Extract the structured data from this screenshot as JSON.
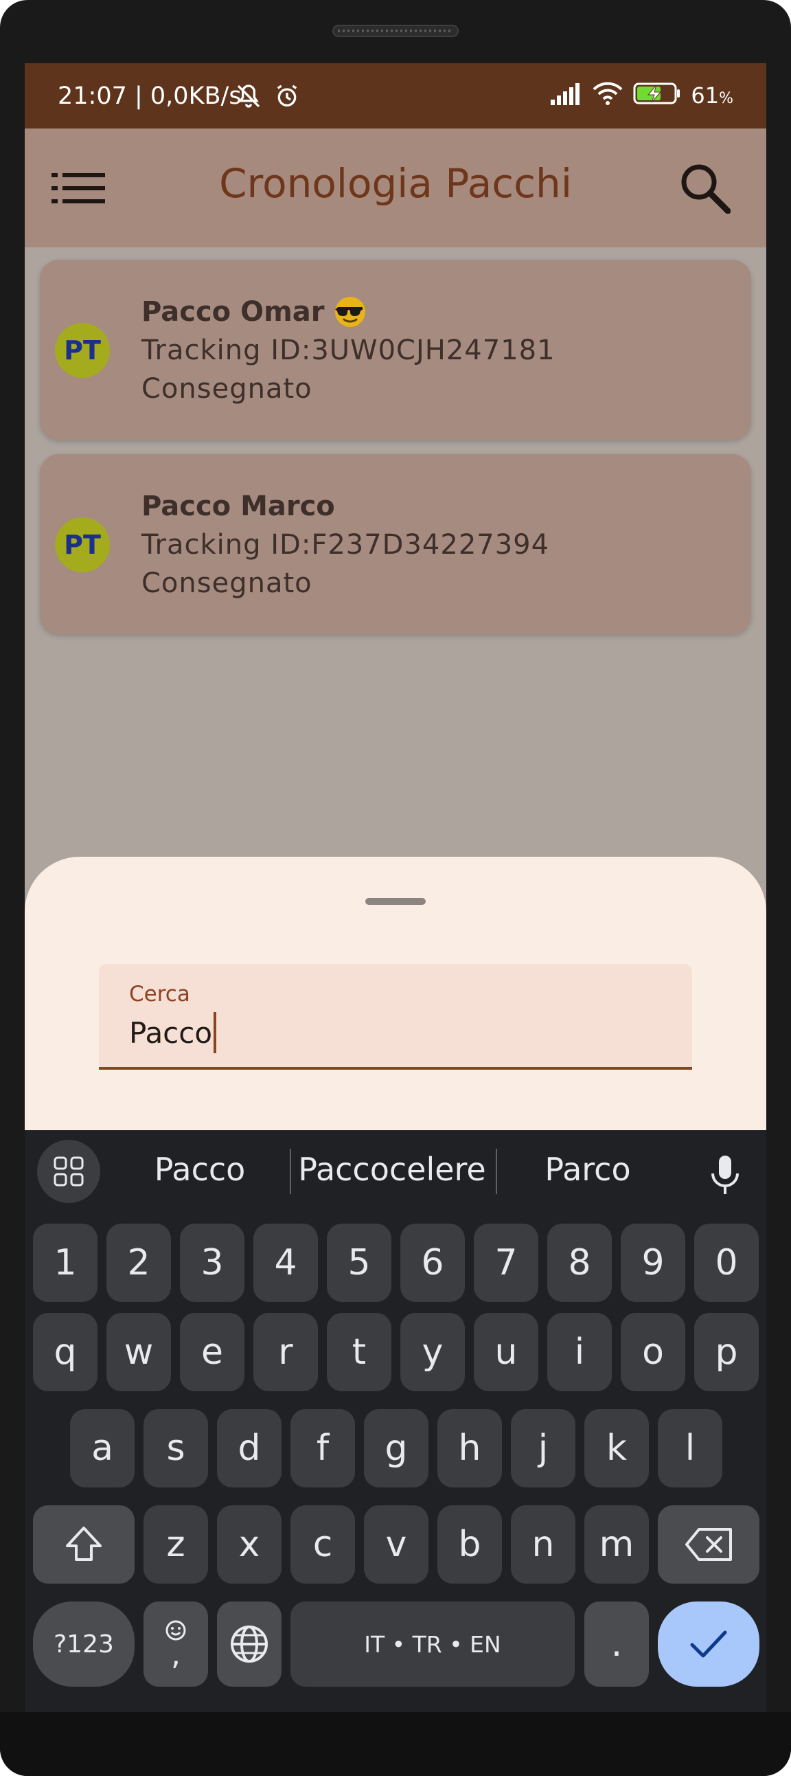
{
  "status_bar": {
    "time_speed": "21:07 | 0,0KB/s",
    "battery_percent": "61",
    "battery_unit": "%"
  },
  "app_bar": {
    "title": "Cronologia Pacchi",
    "menu_icon": "list-menu-icon",
    "search_icon": "search-icon"
  },
  "packages": [
    {
      "avatar": "PT",
      "name": "Pacco Omar",
      "emoji": "smiling-face-with-sunglasses",
      "tracking": "Tracking ID:3UW0CJH247181",
      "status": "Consegnato"
    },
    {
      "avatar": "PT",
      "name": "Pacco Marco",
      "tracking": "Tracking ID:F237D34227394",
      "status": "Consegnato"
    }
  ],
  "search_sheet": {
    "label": "Cerca",
    "value": "Pacco"
  },
  "keyboard": {
    "suggestions": [
      "Pacco",
      "Paccocelere",
      "Parco"
    ],
    "number_row": [
      "1",
      "2",
      "3",
      "4",
      "5",
      "6",
      "7",
      "8",
      "9",
      "0"
    ],
    "row1": [
      "q",
      "w",
      "e",
      "r",
      "t",
      "y",
      "u",
      "i",
      "o",
      "p"
    ],
    "row2": [
      "a",
      "s",
      "d",
      "f",
      "g",
      "h",
      "j",
      "k",
      "l"
    ],
    "row3": [
      "z",
      "x",
      "c",
      "v",
      "b",
      "n",
      "m"
    ],
    "symbols_label": "?123",
    "comma_label": ",",
    "space_label": "IT • TR • EN",
    "period_label": "."
  },
  "colors": {
    "status_bar": "#5e341c",
    "app_bar": "#a68a7d",
    "title_text": "#6e361b",
    "card": "#a68b80",
    "avatar_bg": "#a4ac1e",
    "avatar_text": "#1c2f8c",
    "sheet": "#faede4",
    "field_accent": "#8b4422",
    "keyboard_bg": "#202124",
    "enter_key": "#a8c7fa"
  }
}
